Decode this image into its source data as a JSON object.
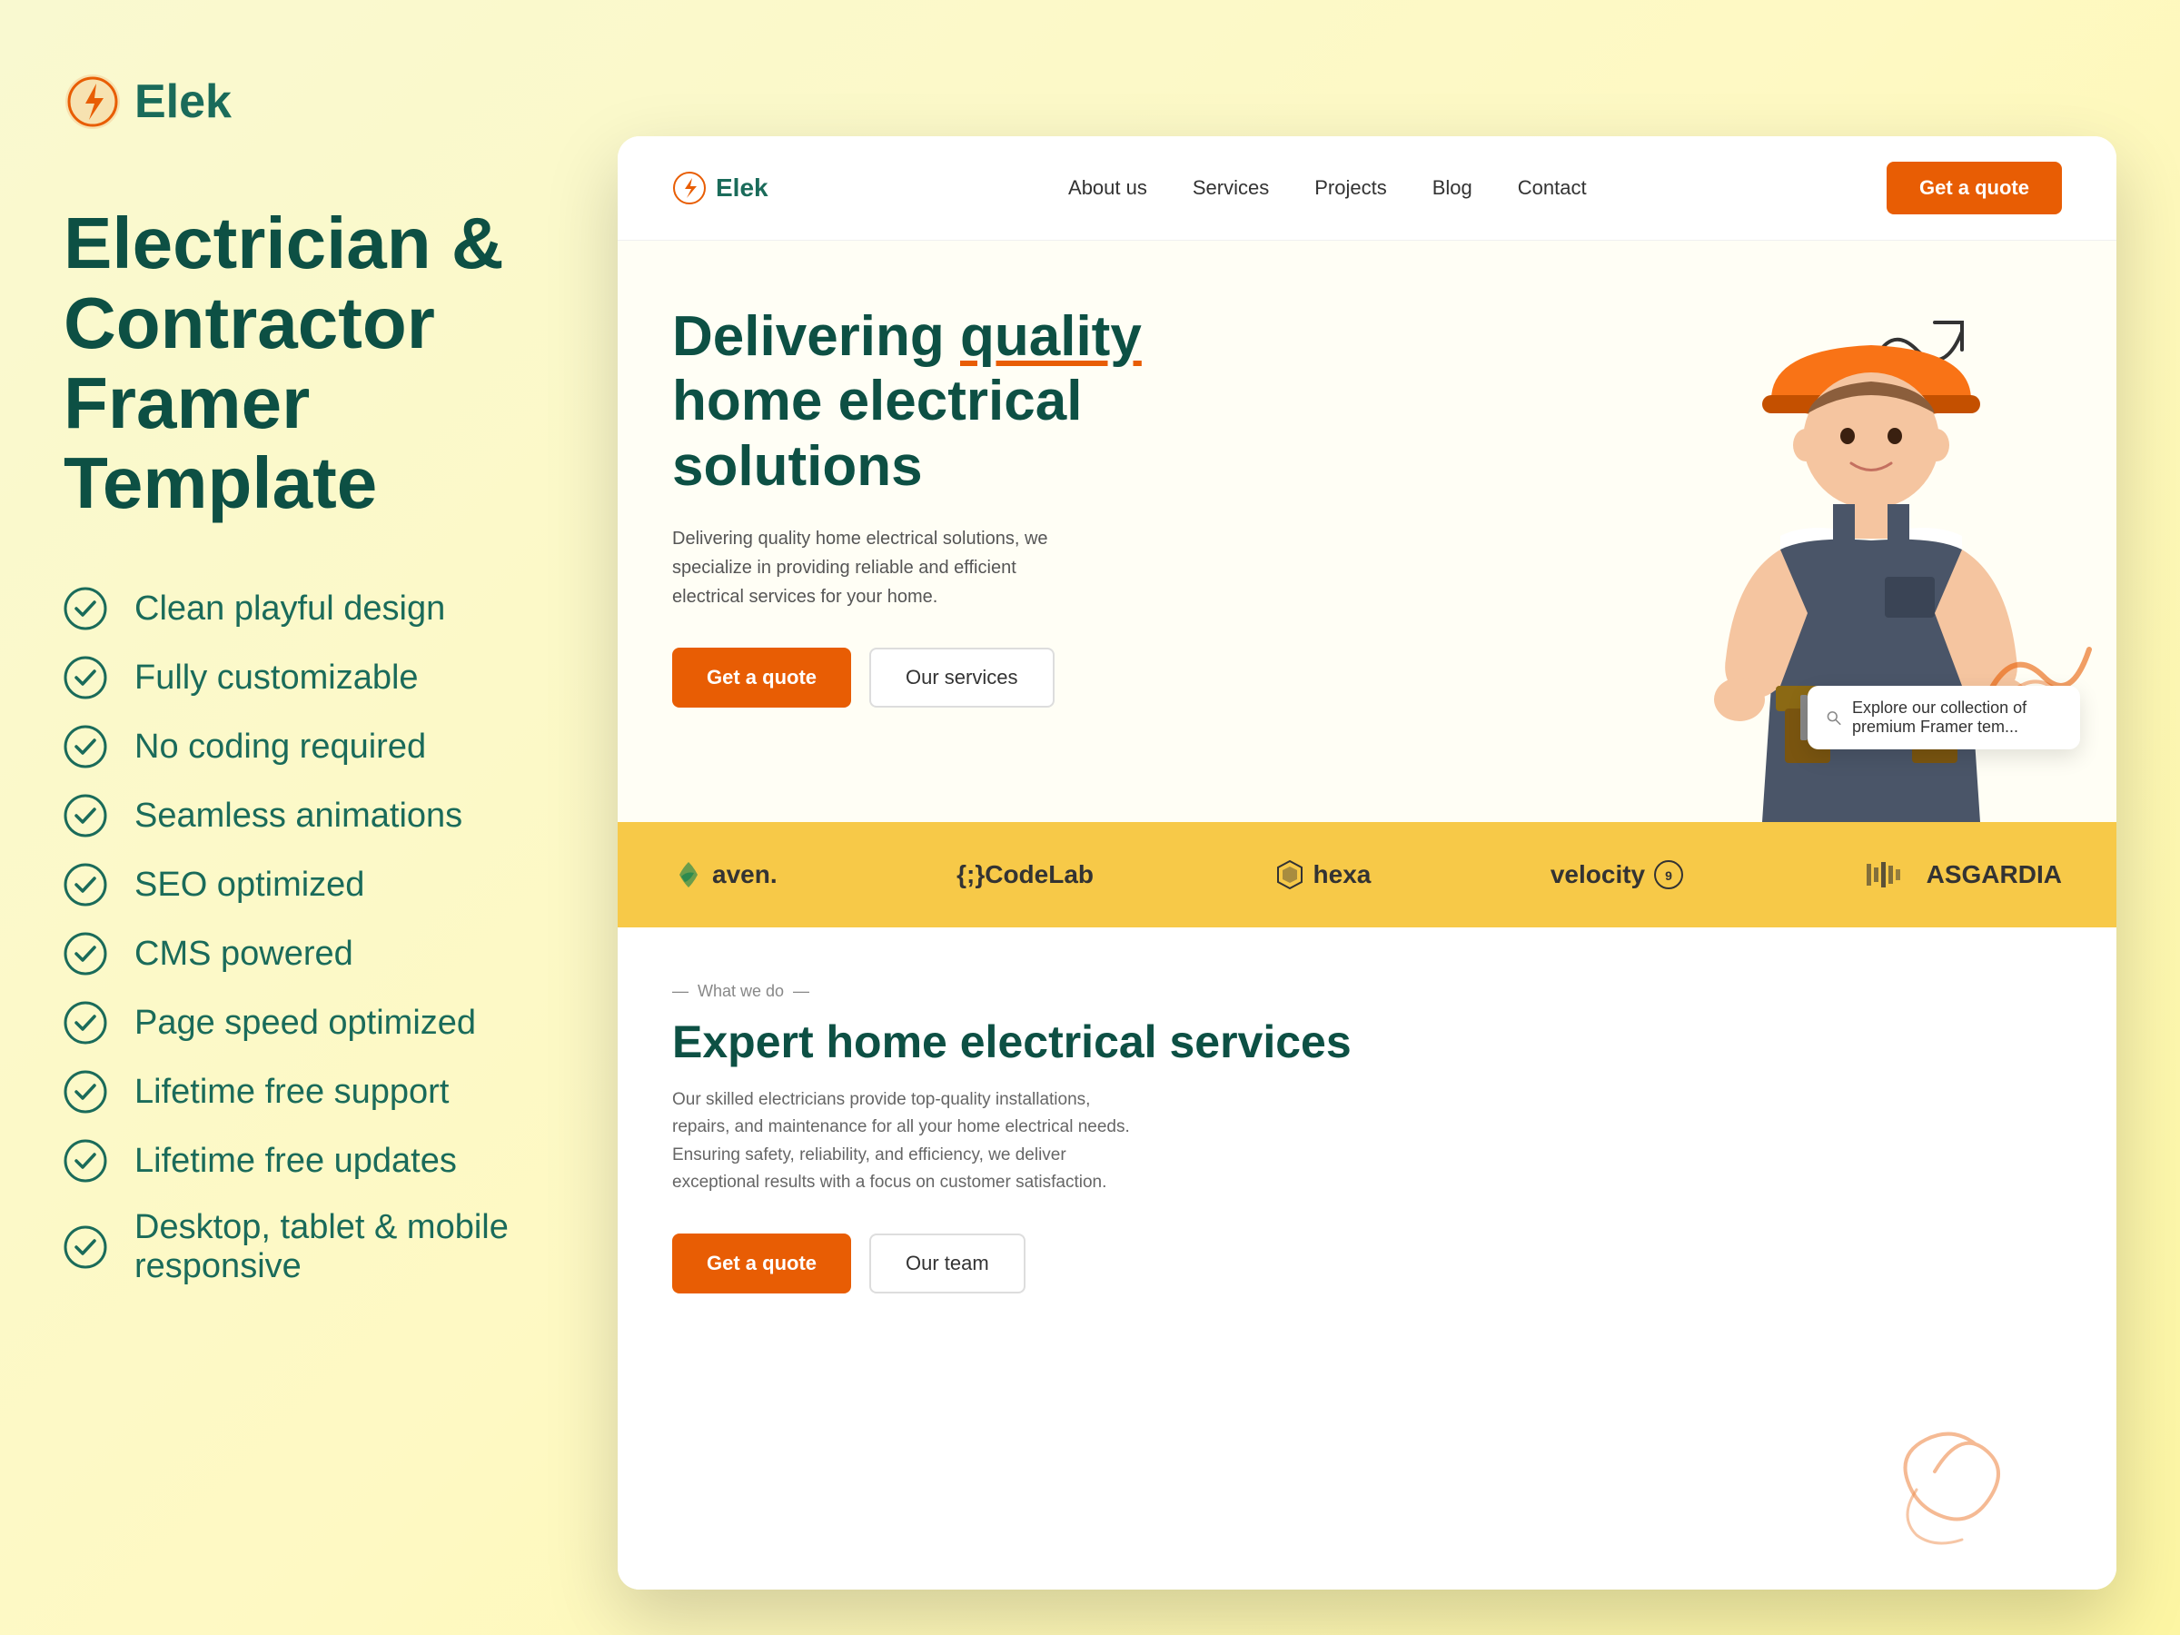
{
  "brand": {
    "name": "Elek",
    "tagline": "Electrician & Contractor Framer Template"
  },
  "features": [
    "Clean playful design",
    "Fully customizable",
    "No coding required",
    "Seamless animations",
    "SEO optimized",
    "CMS powered",
    "Page speed optimized",
    "Lifetime free support",
    "Lifetime free updates",
    "Desktop, tablet & mobile responsive"
  ],
  "nav": {
    "brand": "Elek",
    "links": [
      "About us",
      "Services",
      "Projects",
      "Blog",
      "Contact"
    ],
    "cta": "Get a quote"
  },
  "hero": {
    "title_part1": "Delivering ",
    "title_highlight": "quality",
    "title_part2": " home electrical solutions",
    "description": "Delivering quality home electrical solutions, we specialize in providing reliable and efficient electrical services for your home.",
    "btn_primary": "Get a quote",
    "btn_secondary": "Our services"
  },
  "logos": [
    {
      "name": "aven.",
      "icon": "🌱"
    },
    {
      "name": "{;}CodeLab"
    },
    {
      "name": "hexa",
      "icon": "⬡"
    },
    {
      "name": "velocity",
      "suffix": "9"
    },
    {
      "name": "ASGARDIA"
    }
  ],
  "services": {
    "label": "What we do",
    "title": "Expert home electrical services",
    "description": "Our skilled electricians provide top-quality installations, repairs, and maintenance for all your home electrical needs. Ensuring safety, reliability, and efficiency, we deliver exceptional results with a focus on customer satisfaction.",
    "btn_primary": "Get a quote",
    "btn_secondary": "Our team"
  },
  "explore_tooltip": "Explore our collection of premium Framer tem...",
  "colors": {
    "teal": "#0d5044",
    "orange": "#e85d04",
    "yellow": "#f7c948"
  }
}
